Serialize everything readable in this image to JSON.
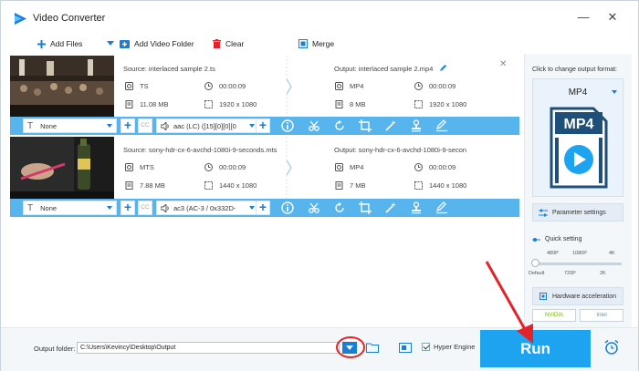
{
  "window": {
    "title": "Video Converter",
    "controls": {
      "minimize": "—",
      "close": "✕"
    }
  },
  "toolbar": {
    "add_files": "Add Files",
    "add_video_folder": "Add Video Folder",
    "clear": "Clear",
    "merge": "Merge"
  },
  "files": [
    {
      "source": "Source: interlaced sample 2.ts",
      "output": "Output: interlaced sample 2.mp4",
      "src_format": "TS",
      "src_duration": "00:00:09",
      "src_size": "11.08 MB",
      "src_resolution": "1920 x 1080",
      "out_format": "MP4",
      "out_duration": "00:00:09",
      "out_size": "8 MB",
      "out_resolution": "1920 x 1080",
      "subtitle": "None",
      "audio": "aac (LC) ([15][0][0][0"
    },
    {
      "source": "Source: sony-hdr-cx-6-avchd-1080i-9-seconds.mts",
      "output": "Output: sony-hdr-cx-6-avchd-1080i-9-secon",
      "src_format": "MTS",
      "src_duration": "00:00:09",
      "src_size": "7.88 MB",
      "src_resolution": "1440 x 1080",
      "out_format": "MP4",
      "out_duration": "00:00:09",
      "out_size": "7 MB",
      "out_resolution": "1440 x 1080",
      "subtitle": "None",
      "audio": "ac3 (AC-3 / 0x332D-"
    }
  ],
  "cc_label": "CC",
  "right_panel": {
    "click_to_change": "Click to change output format:",
    "format": "MP4",
    "format_icon_text": "MP4",
    "parameter_settings": "Parameter settings",
    "quick_setting": "Quick setting",
    "qs_top": [
      "480P",
      "1080P",
      "4K"
    ],
    "qs_bottom": [
      "Default",
      "720P",
      "2K"
    ],
    "hardware_acceleration": "Hardware acceleration",
    "nvidia": "NVIDIA",
    "intel": "Intel"
  },
  "footer": {
    "output_folder_label": "Output folder:",
    "output_folder_value": "C:\\Users\\Kevincy\\Desktop\\Output",
    "hyper_engine": "Hyper Engine",
    "run": "Run"
  },
  "colors": {
    "accent": "#1ea3f1",
    "bar": "#58b4ec",
    "highlight": "#e3232a"
  }
}
